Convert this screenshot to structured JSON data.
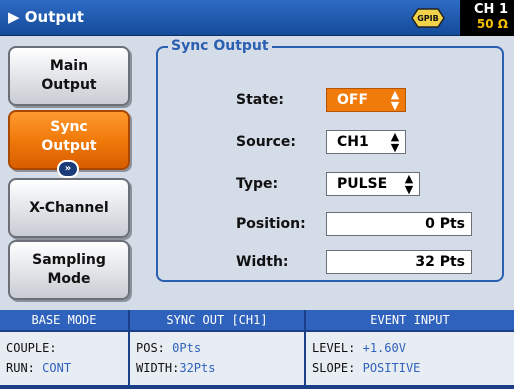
{
  "header": {
    "title": "Output",
    "title_icon": "play-triangle",
    "gpib": "GPIB",
    "channel": "CH 1",
    "impedance": "50 Ω"
  },
  "sidebar": {
    "items": [
      {
        "line1": "Main",
        "line2": "Output",
        "active": false
      },
      {
        "line1": "Sync",
        "line2": "Output",
        "active": true
      },
      {
        "line1": "X-Channel",
        "line2": "",
        "active": false
      },
      {
        "line1": "Sampling",
        "line2": "Mode",
        "active": false
      }
    ],
    "expand_icon": "double-chevron-down-icon"
  },
  "sync_output": {
    "title": "Sync Output",
    "state": {
      "label": "State:",
      "value": "OFF"
    },
    "source": {
      "label": "Source:",
      "value": "CH1"
    },
    "type": {
      "label": "Type:",
      "value": "PULSE"
    },
    "position": {
      "label": "Position:",
      "value": "0 Pts"
    },
    "width": {
      "label": "Width:",
      "value": "32 Pts"
    }
  },
  "status": {
    "base_mode": {
      "header": "BASE MODE",
      "couple_label": "COUPLE:",
      "couple_value": "",
      "run_label": "RUN:",
      "run_value": "CONT"
    },
    "sync_out": {
      "header": "SYNC OUT [CH1]",
      "pos_label": "POS:",
      "pos_value": "0Pts",
      "width_label": "WIDTH:",
      "width_value": "32Pts"
    },
    "event_input": {
      "header": "EVENT INPUT",
      "level_label": "LEVEL:",
      "level_value": "+1.60V",
      "slope_label": "SLOPE:",
      "slope_value": "POSITIVE"
    }
  },
  "colors": {
    "accent_orange": "#f07a0a",
    "accent_blue": "#2b5fb0",
    "impedance_yellow": "#f4c000"
  }
}
